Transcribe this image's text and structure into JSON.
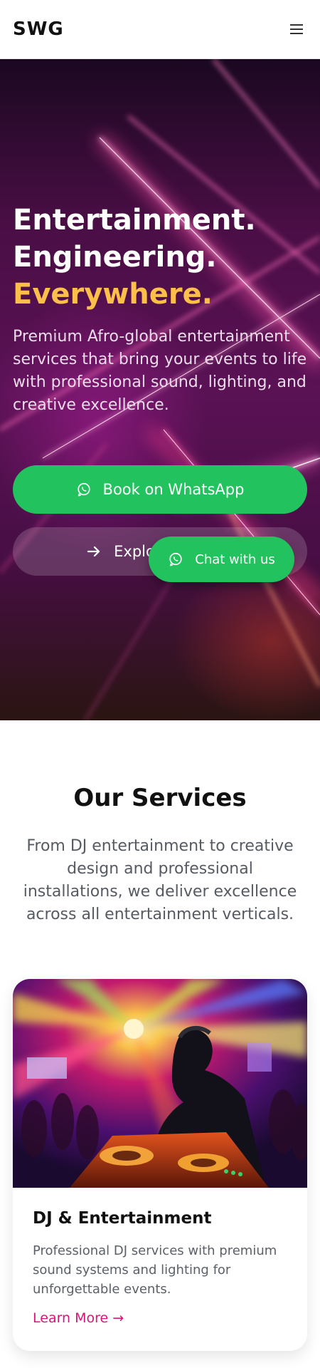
{
  "header": {
    "logo": "SWG",
    "menu_icon": "hamburger-menu-icon"
  },
  "hero": {
    "title_line1": "Entertainment.",
    "title_line2": "Engineering.",
    "title_accent": "Everywhere.",
    "description": "Premium Afro-global entertainment services that bring your events to life with professional sound, lighting, and creative excellence.",
    "whatsapp_button": "Book on WhatsApp",
    "explore_button": "Explo",
    "chat_button": "Chat with us",
    "accent_color": "#fbbf4a",
    "whatsapp_color": "#22c35e"
  },
  "services": {
    "title": "Our Services",
    "description": "From DJ entertainment to creative design and professional installations, we deliver excellence across all entertainment verticals.",
    "cards": [
      {
        "title": "DJ & Entertainment",
        "description": "Professional DJ services with premium sound systems and lighting for unforgettable events.",
        "link": "Learn More →",
        "link_color": "#d3187a"
      }
    ]
  }
}
